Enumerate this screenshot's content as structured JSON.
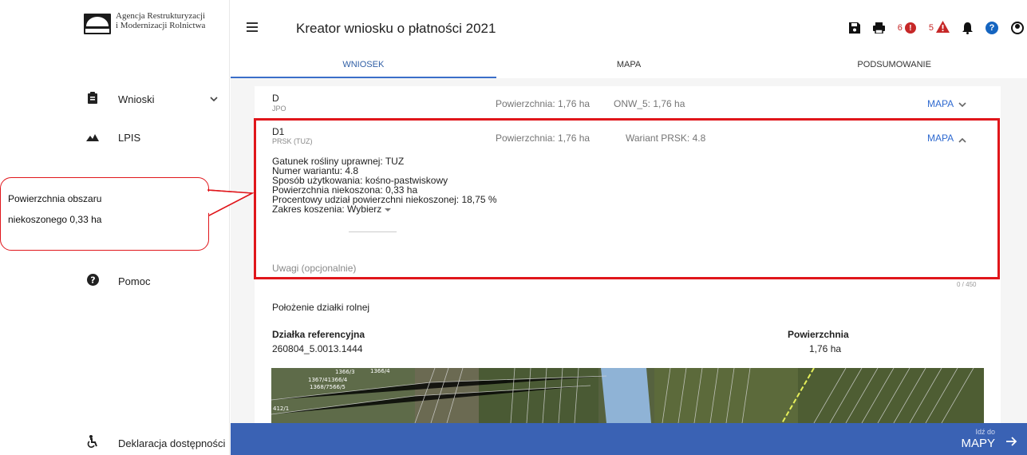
{
  "brand": {
    "line1": "Agencja Restrukturyzacji",
    "line2": "i Modernizacji Rolnictwa",
    "badge": "ARiMR"
  },
  "sidebar": {
    "items": [
      {
        "label": "Wnioski",
        "icon": "clipboard-icon"
      },
      {
        "label": "LPIS",
        "icon": "mountain-icon"
      },
      {
        "label": "Pomoc",
        "icon": "help-circle-icon"
      },
      {
        "label": "Deklaracja dostępności",
        "icon": "accessibility-icon"
      }
    ]
  },
  "header": {
    "title": "Kreator wniosku o płatności 2021",
    "error_count": "6",
    "warning_count": "5"
  },
  "tabs": [
    {
      "label": "WNIOSEK",
      "active": true
    },
    {
      "label": "MAPA",
      "active": false
    },
    {
      "label": "PODSUMOWANIE",
      "active": false
    }
  ],
  "row_d": {
    "code": "D",
    "type": "JPO",
    "area": "Powierzchnia: 1,76 ha",
    "extra": "ONW_5: 1,76 ha",
    "map_link": "MAPA"
  },
  "row_d1": {
    "code": "D1",
    "type": "PRSK (TUZ)",
    "area": "Powierzchnia: 1,76 ha",
    "extra": "Wariant PRSK: 4.8",
    "map_link": "MAPA",
    "details": {
      "gatunek": "Gatunek rośliny uprawnej: TUZ",
      "wariant": "Numer wariantu: 4.8",
      "sposob": "Sposób użytkowania: kośno-pastwiskowy",
      "niekoszona": "Powierzchnia niekoszona: 0,33 ha",
      "procent": "Procentowy udział powierzchni niekoszonej: 18,75 %",
      "zakres_label": "Zakres koszenia:",
      "zakres_value": "Wybierz"
    },
    "remarks_placeholder": "Uwagi (opcjonalnie)",
    "counter": "0 / 450"
  },
  "location": {
    "title": "Położenie działki rolnej",
    "col1": "Działka referencyjna",
    "col2": "Powierzchnia",
    "parcel_id": "260804_5.0013.1444",
    "parcel_area": "1,76 ha",
    "map_labels": [
      "1366/3",
      "1366/4",
      "1367/41366/4",
      "1368/7566/5",
      "412/1"
    ]
  },
  "callout": {
    "line1": "Powierzchnia obszaru",
    "line2": "niekoszonego 0,33 ha"
  },
  "bottombar": {
    "small": "Idź do",
    "big": "MAPY"
  },
  "colors": {
    "accent": "#3a62b4",
    "highlight": "#e0161b",
    "error": "#c62828",
    "help": "#1565c0"
  }
}
